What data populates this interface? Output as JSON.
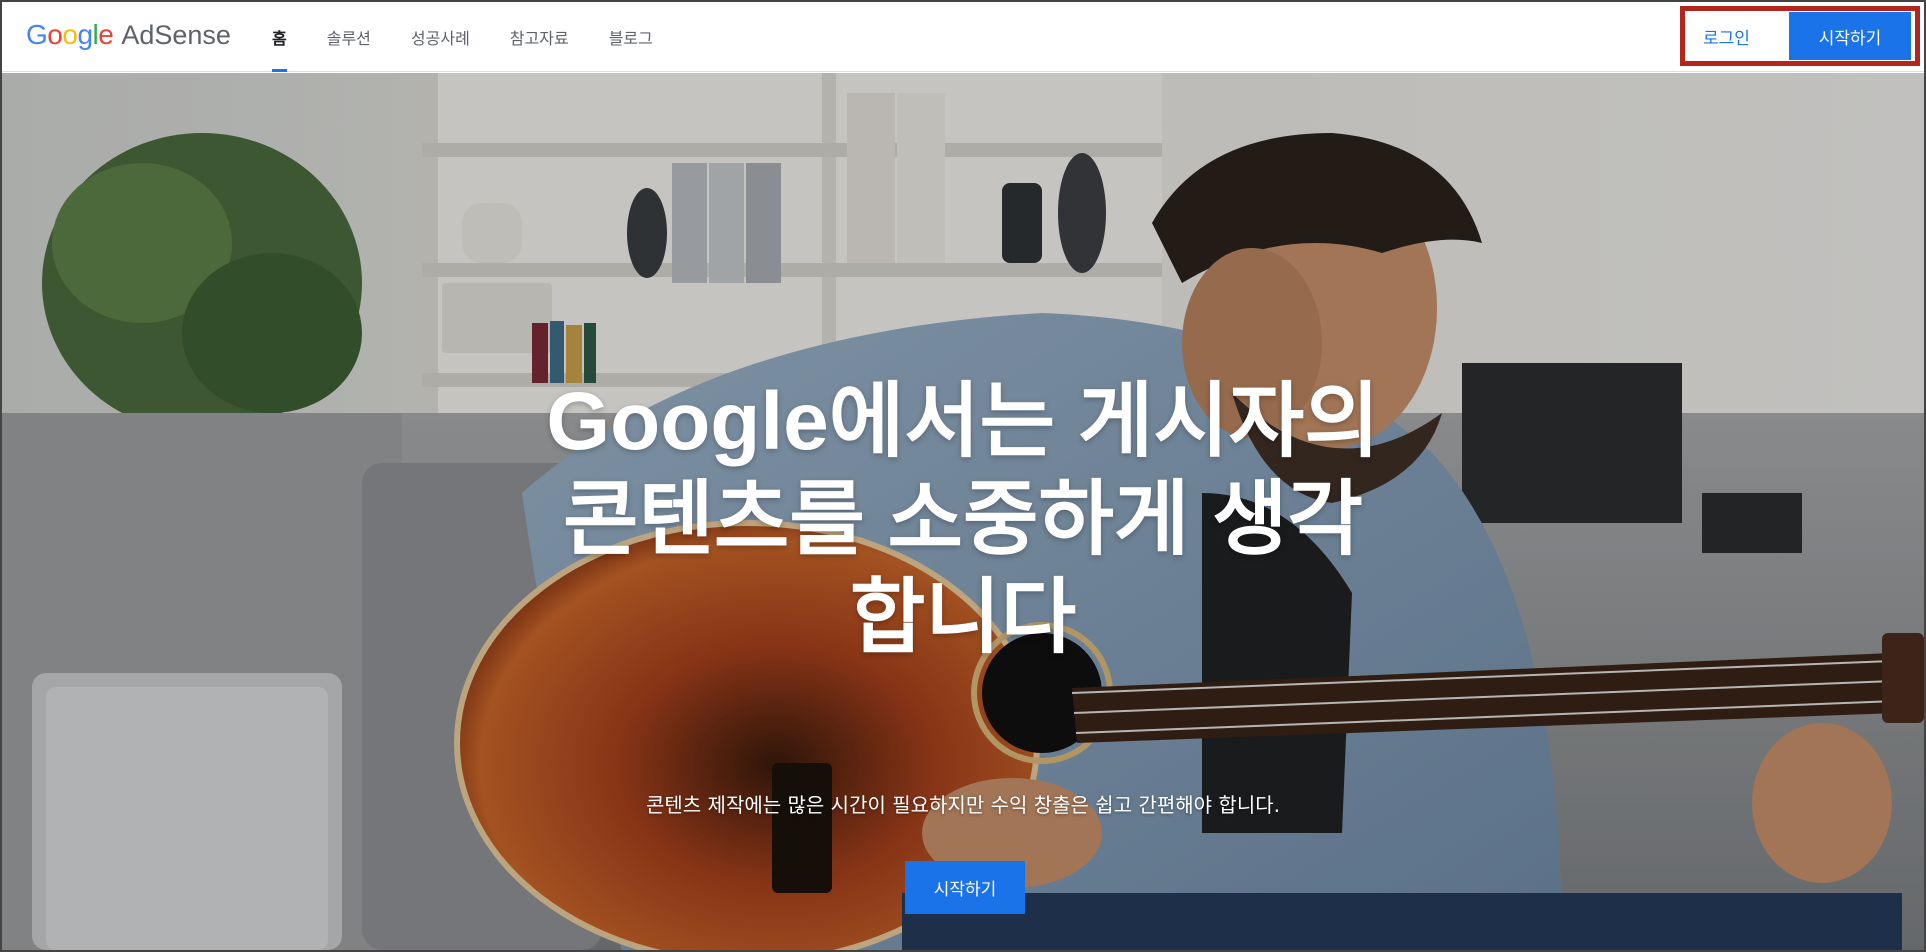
{
  "header": {
    "logo": {
      "google": [
        "G",
        "o",
        "o",
        "g",
        "l",
        "e"
      ],
      "product": "AdSense"
    },
    "nav": [
      {
        "label": "홈",
        "active": true
      },
      {
        "label": "솔루션",
        "active": false
      },
      {
        "label": "성공사례",
        "active": false
      },
      {
        "label": "참고자료",
        "active": false
      },
      {
        "label": "블로그",
        "active": false
      }
    ],
    "login_label": "로그인",
    "start_label": "시작하기"
  },
  "hero": {
    "title_lines": [
      "Google에서는 게시자의",
      "콘텐츠를 소중하게 생각",
      "합니다"
    ],
    "subtitle": "콘텐츠 제작에는 많은 시간이 필요하지만 수익 창출은 쉽고 간편해야 합니다.",
    "cta_label": "시작하기",
    "image": "man-playing-acoustic-guitar-on-sofa"
  },
  "colors": {
    "accent": "#1a73e8",
    "highlight_border": "#b3261e",
    "nav_text": "#5f6368"
  }
}
